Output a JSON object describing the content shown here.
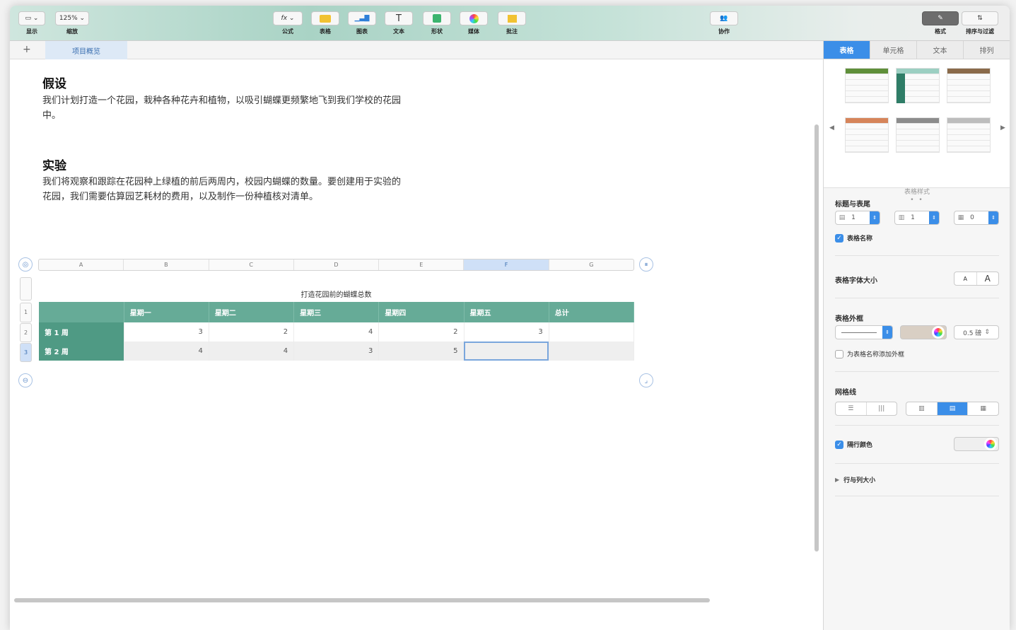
{
  "toolbar": {
    "view_label": "显示",
    "zoom_value": "125%",
    "zoom_label": "缩放",
    "formula_label": "公式",
    "table_label": "表格",
    "chart_label": "图表",
    "text_label": "文本",
    "shape_label": "形状",
    "media_label": "媒体",
    "comment_label": "批注",
    "collaborate_label": "协作",
    "format_label": "格式",
    "sort_filter_label": "排序与过滤"
  },
  "sheet": {
    "tab_label": "项目概览"
  },
  "doc": {
    "heading1": "假设",
    "para1": "我们计划打造一个花园，栽种各种花卉和植物，以吸引蝴蝶更频繁地飞到我们学校的花园中。",
    "heading2": "实验",
    "para2": "我们将观察和跟踪在花园种上绿植的前后两周内，校园内蝴蝶的数量。要创建用于实验的花园，我们需要估算园艺耗材的费用，以及制作一份种植核对清单。"
  },
  "table": {
    "caption": "打造花园前的蝴蝶总数",
    "column_headers": [
      "A",
      "B",
      "C",
      "D",
      "E",
      "F",
      "G"
    ],
    "row_headers": [
      "1",
      "2",
      "3"
    ],
    "header_row": [
      "",
      "星期一",
      "星期二",
      "星期三",
      "星期四",
      "星期五",
      "总计"
    ],
    "rows": [
      [
        "第 1 周",
        "3",
        "2",
        "4",
        "2",
        "3",
        ""
      ],
      [
        "第 2 周",
        "4",
        "4",
        "3",
        "5",
        "",
        ""
      ]
    ]
  },
  "panel": {
    "tabs": [
      "表格",
      "单元格",
      "文本",
      "排列"
    ],
    "table_styles_label": "表格样式",
    "headers_footer_title": "标题与表尾",
    "header_rows_value": "1",
    "header_cols_value": "1",
    "footer_rows_value": "0",
    "table_name_label": "表格名称",
    "font_size_title": "表格字体大小",
    "font_small": "A",
    "font_large": "A",
    "outline_title": "表格外框",
    "outline_width_value": "0.5 磅",
    "outline_name_label": "为表格名称添加外框",
    "gridlines_title": "网格线",
    "alternating_label": "隔行颜色",
    "row_col_size_label": "行与列大小",
    "style_colors": [
      "#5f8f3a",
      "#5aa592",
      "#8a6a4a",
      "#d6845a",
      "#8c8c8c",
      "#bdbdbd"
    ]
  }
}
